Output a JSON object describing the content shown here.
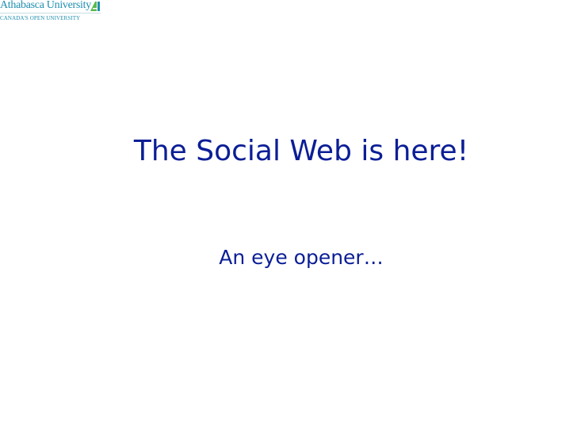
{
  "logo": {
    "name": "Athabasca University",
    "tagline": "CANADA'S OPEN UNIVERSITY",
    "mark_icon": "athabasca-a-icon",
    "colors": {
      "text": "#1f8fb0",
      "mark_green": "#5bb94a",
      "mark_teal": "#1f8fb0"
    }
  },
  "slide": {
    "title": "The Social Web is here!",
    "subtitle": "An eye opener…",
    "text_color": "#0b1e96",
    "background": "#ffffff"
  }
}
